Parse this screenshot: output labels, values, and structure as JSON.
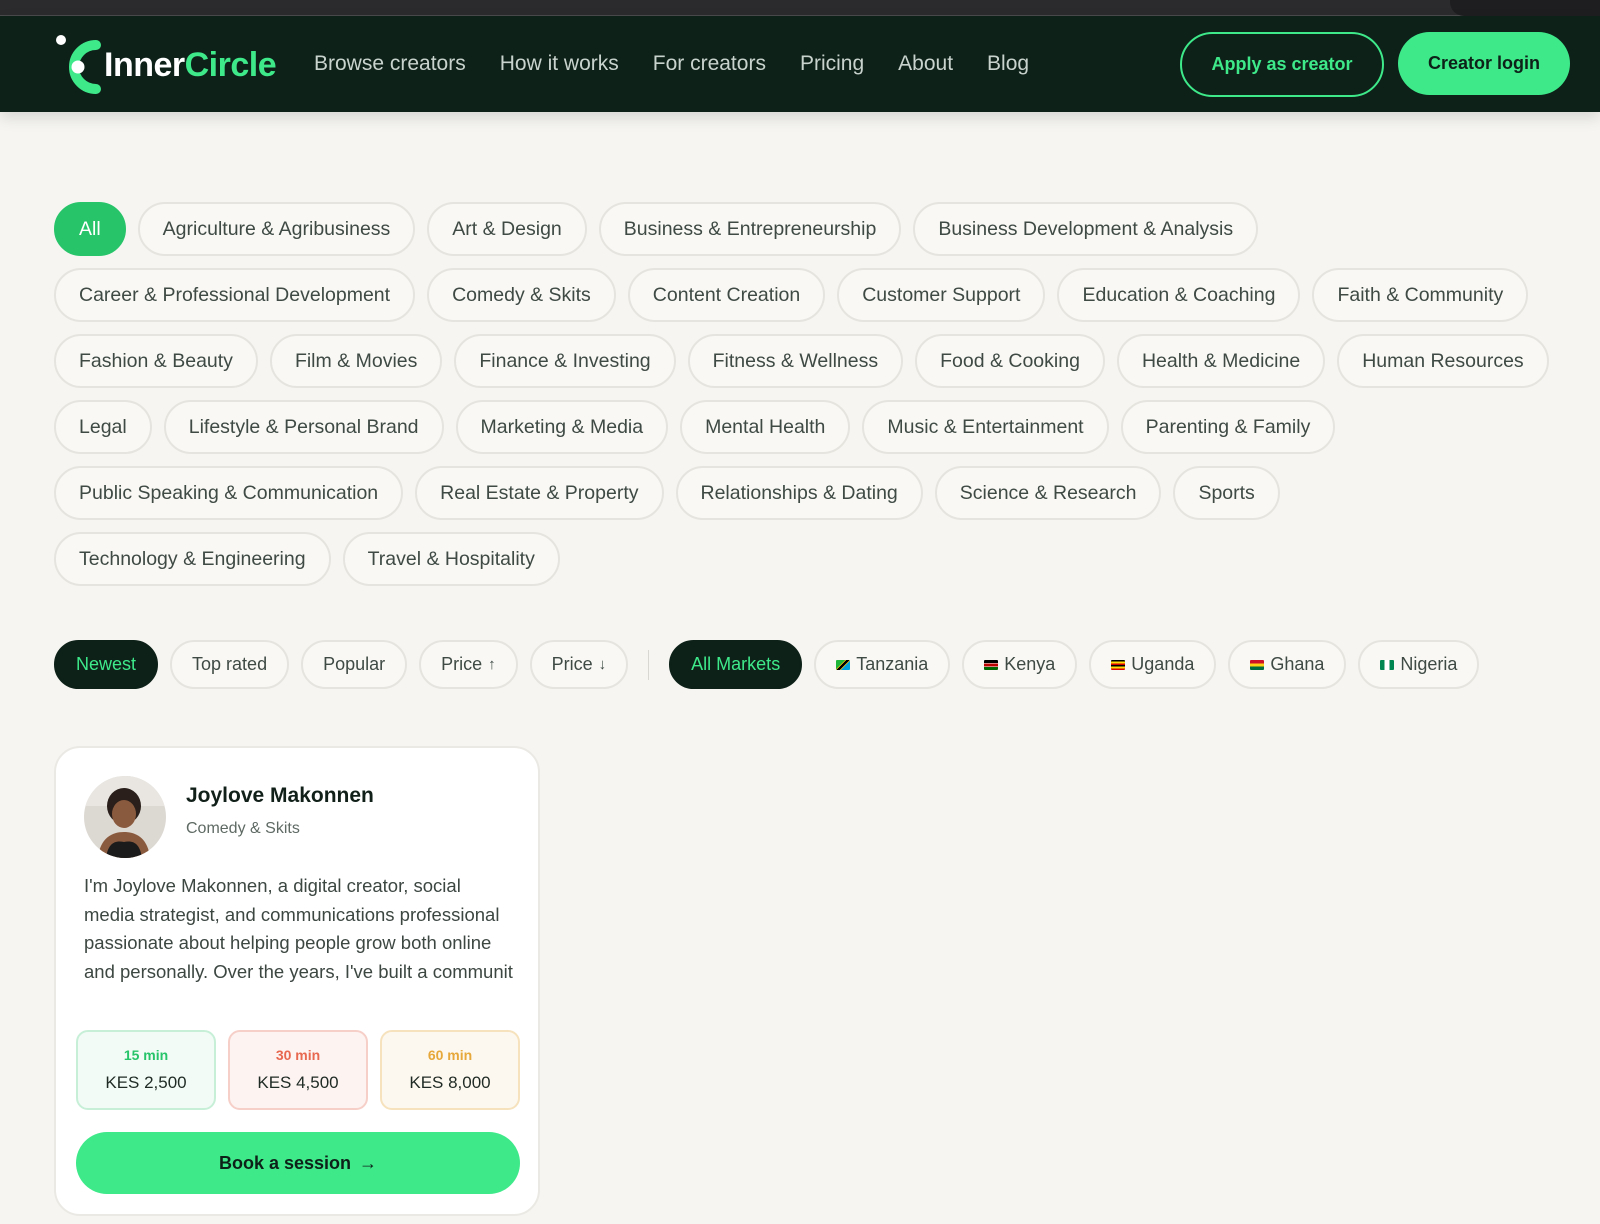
{
  "brand": {
    "name_part1": "Inner",
    "name_part2": "Circle",
    "primary_color": "#3ee98a",
    "dark_color": "#0d2119",
    "accent_green": "#27c46a"
  },
  "nav": {
    "links": [
      "Browse creators",
      "How it works",
      "For creators",
      "Pricing",
      "About",
      "Blog"
    ],
    "apply_label": "Apply as creator",
    "login_label": "Creator login"
  },
  "categories": [
    "All",
    "Agriculture & Agribusiness",
    "Art & Design",
    "Business & Entrepreneurship",
    "Business Development & Analysis",
    "Career & Professional Development",
    "Comedy & Skits",
    "Content Creation",
    "Customer Support",
    "Education & Coaching",
    "Faith & Community",
    "Fashion & Beauty",
    "Film & Movies",
    "Finance & Investing",
    "Fitness & Wellness",
    "Food & Cooking",
    "Health & Medicine",
    "Human Resources",
    "Legal",
    "Lifestyle & Personal Brand",
    "Marketing & Media",
    "Mental Health",
    "Music & Entertainment",
    "Parenting & Family",
    "Public Speaking & Communication",
    "Real Estate & Property",
    "Relationships & Dating",
    "Science & Research",
    "Sports",
    "Technology & Engineering",
    "Travel & Hospitality"
  ],
  "active_category": "All",
  "sort_options": [
    "Newest",
    "Top rated",
    "Popular",
    "Price",
    "Price"
  ],
  "sort_arrows": [
    "",
    "",
    "",
    "↑",
    "↓"
  ],
  "active_sort": "Newest",
  "markets": [
    "All Markets",
    "Tanzania",
    "Kenya",
    "Uganda",
    "Ghana",
    "Nigeria"
  ],
  "market_flag_icons": [
    "",
    "tanzania-flag-icon",
    "kenya-flag-icon",
    "uganda-flag-icon",
    "ghana-flag-icon",
    "nigeria-flag-icon"
  ],
  "active_market": "All Markets",
  "creator": {
    "name": "Joylove Makonnen",
    "category": "Comedy & Skits",
    "bio": "I'm Joylove Makonnen, a digital creator, social media strategist, and communications professional passionate about helping people grow both online and personally. Over the years, I've built a communit",
    "prices": [
      {
        "duration": "15 min",
        "amount": "KES 2,500"
      },
      {
        "duration": "30 min",
        "amount": "KES 4,500"
      },
      {
        "duration": "60 min",
        "amount": "KES 8,000"
      }
    ],
    "book_label": "Book a session",
    "book_arrow": "→"
  }
}
